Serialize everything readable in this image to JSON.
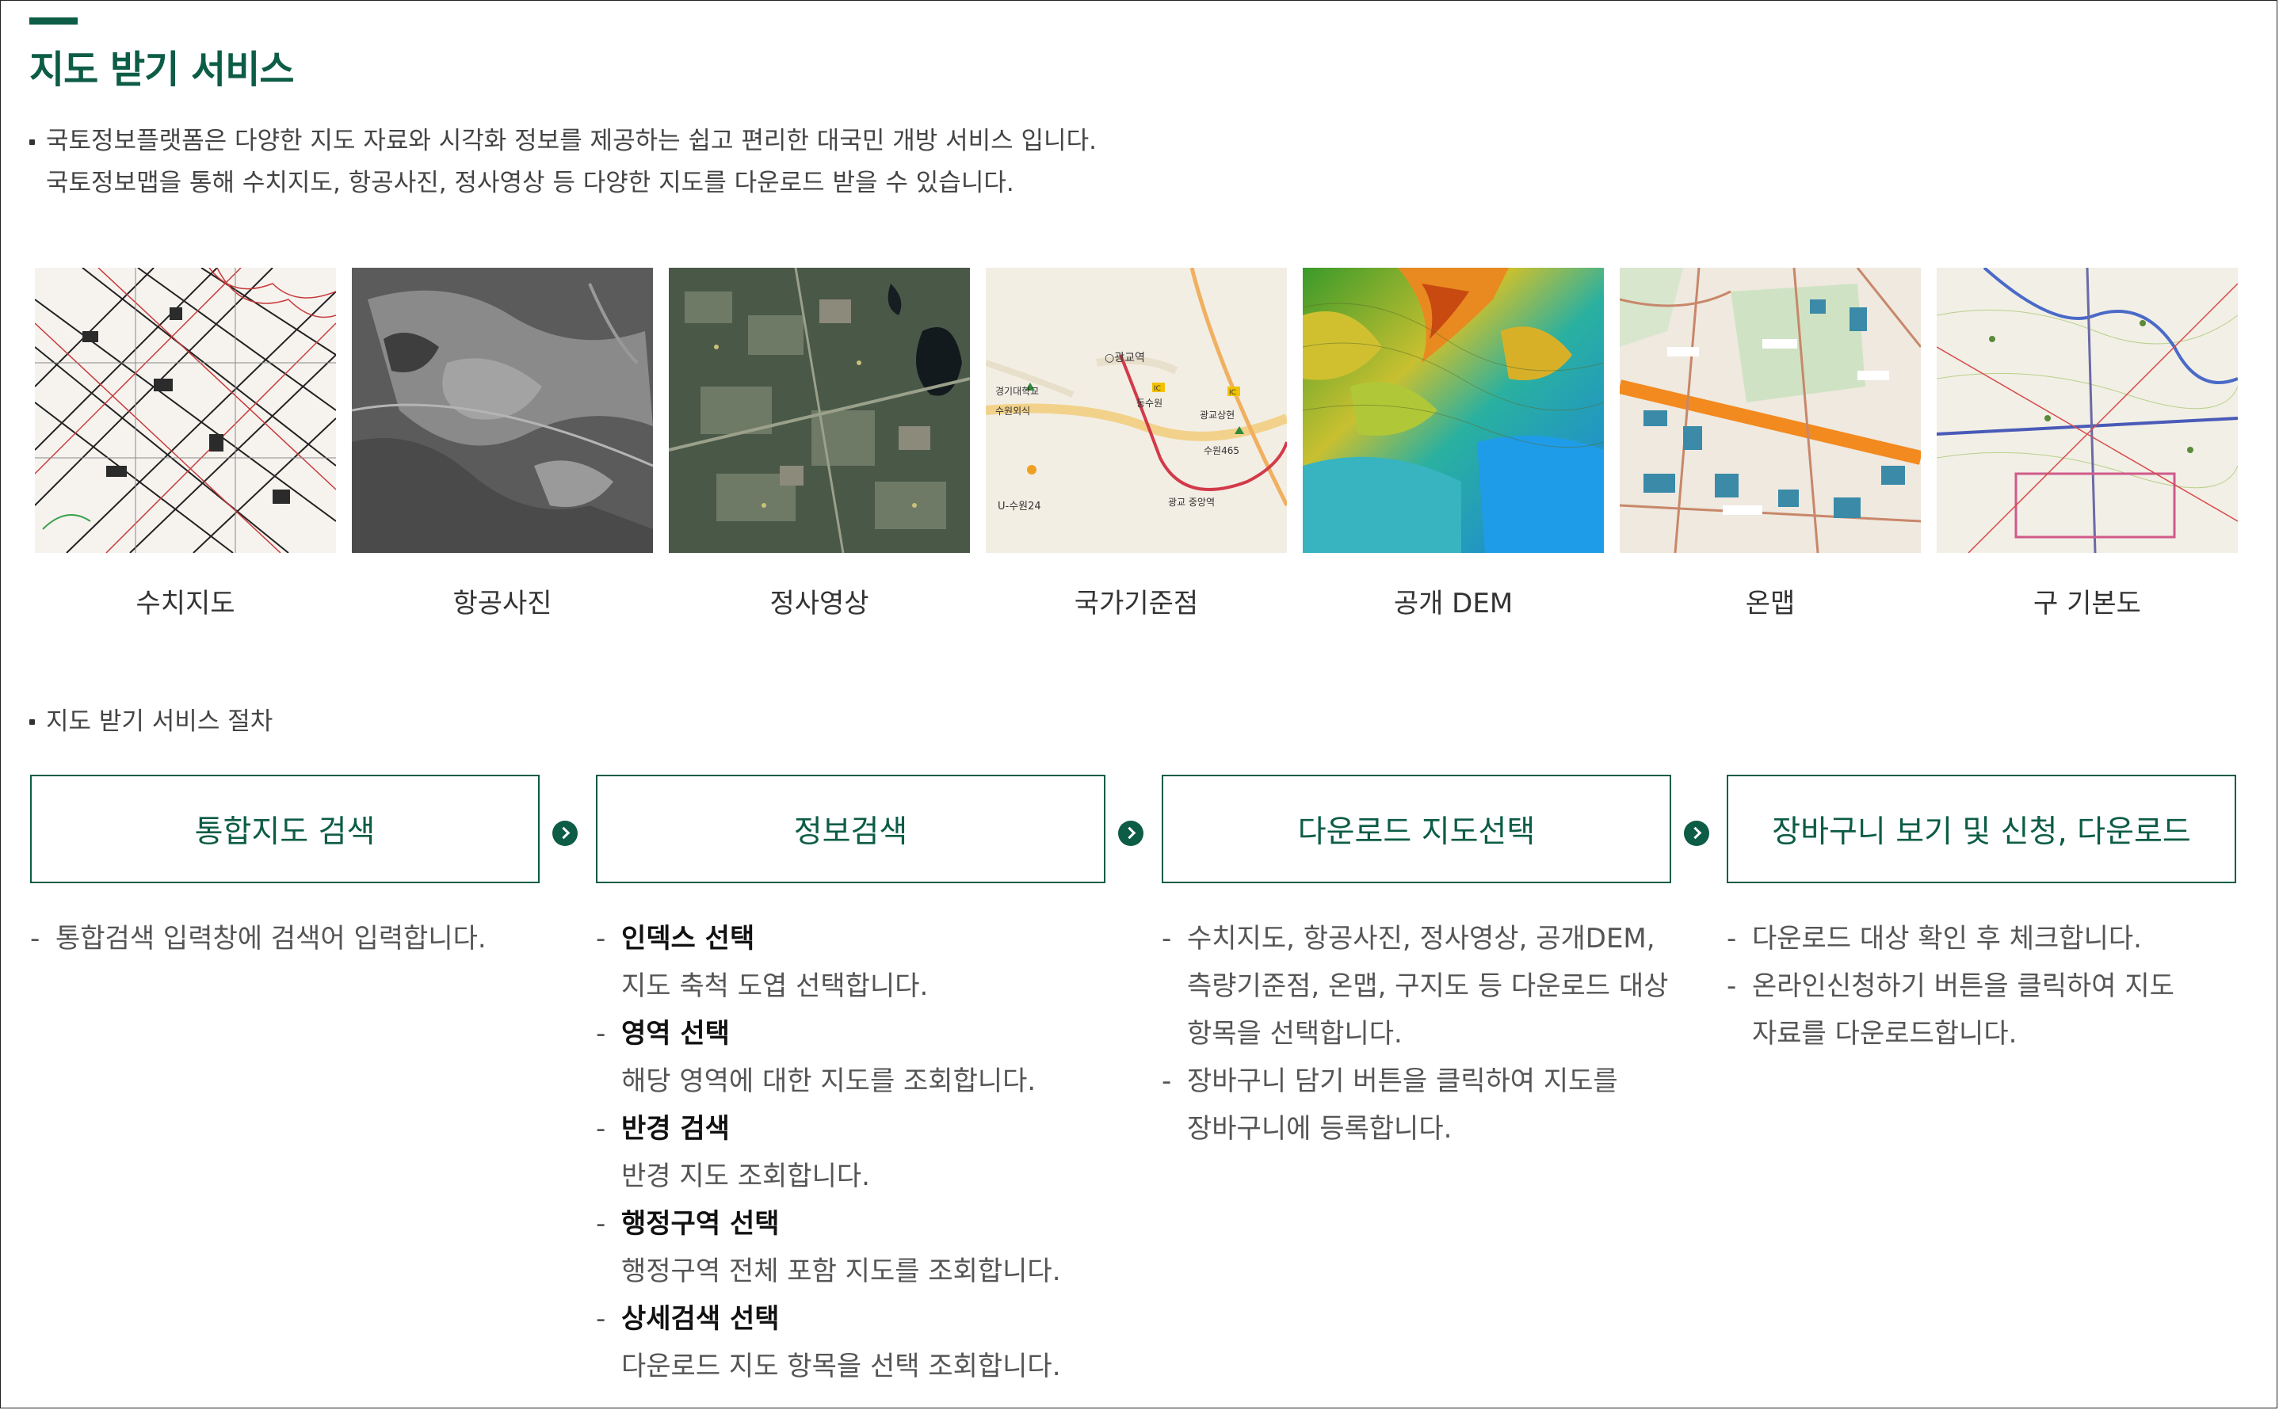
{
  "page": {
    "title": "지도 받기 서비스",
    "intro": [
      "국토정보플랫폼은 다양한 지도 자료와 시각화 정보를 제공하는 쉽고 편리한 대국민 개방 서비스 입니다.",
      "국토정보맵을 통해 수치지도, 항공사진, 정사영상 등 다양한 지도를 다운로드 받을 수 있습니다."
    ],
    "accent_color": "#0c5c46"
  },
  "map_types": [
    {
      "label": "수치지도"
    },
    {
      "label": "항공사진"
    },
    {
      "label": "정사영상"
    },
    {
      "label": "국가기준점",
      "map_text": [
        "○광교역",
        "경기대학교",
        "수원외식",
        "동수원",
        "광교상현",
        "수원465",
        "U-수원24",
        "광교 중앙역",
        "IC",
        "IC"
      ]
    },
    {
      "label": "공개 DEM"
    },
    {
      "label": "온맵"
    },
    {
      "label": "구 기본도"
    }
  ],
  "procedure": {
    "label": "지도 받기 서비스 절차",
    "steps": [
      {
        "title": "통합지도 검색"
      },
      {
        "title": "정보검색"
      },
      {
        "title": "다운로드 지도선택"
      },
      {
        "title": "장바구니 보기 및 신청, 다운로드"
      }
    ],
    "step1_desc": [
      "통합검색 입력창에 검색어 입력합니다."
    ],
    "step2_desc": [
      {
        "title": "인덱스 선택",
        "text": "지도 축척 도엽 선택합니다."
      },
      {
        "title": "영역 선택",
        "text": "해당 영역에 대한 지도를 조회합니다."
      },
      {
        "title": "반경 검색",
        "text": "반경 지도 조회합니다."
      },
      {
        "title": "행정구역 선택",
        "text": "행정구역 전체 포함 지도를 조회합니다."
      },
      {
        "title": "상세검색 선택",
        "text": "다운로드 지도 항목을 선택 조회합니다."
      }
    ],
    "step3_desc": [
      {
        "lines": [
          "수치지도, 항공사진, 정사영상, 공개DEM,",
          "측량기준점, 온맵, 구지도 등 다운로드 대상",
          "항목을 선택합니다."
        ]
      },
      {
        "lines": [
          "장바구니 담기 버튼을 클릭하여 지도를",
          "장바구니에 등록합니다."
        ]
      }
    ],
    "step4_desc": [
      {
        "lines": [
          "다운로드 대상 확인 후 체크합니다."
        ]
      },
      {
        "lines": [
          "온라인신청하기 버튼을 클릭하여 지도",
          "자료를 다운로드합니다."
        ]
      }
    ]
  }
}
